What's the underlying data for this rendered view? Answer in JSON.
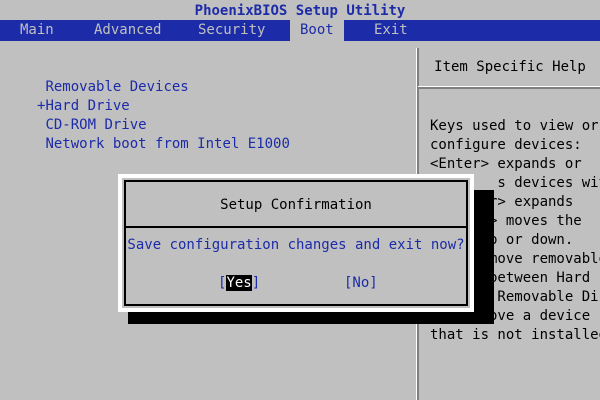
{
  "title": "PhoenixBIOS Setup Utility",
  "menu": [
    "Main",
    "Advanced",
    "Security",
    "Boot",
    "Exit"
  ],
  "active_menu": "Boot",
  "boot_items": [
    {
      "prefix": " ",
      "label": "Removable Devices"
    },
    {
      "prefix": "+",
      "label": "Hard Drive"
    },
    {
      "prefix": " ",
      "label": "CD-ROM Drive"
    },
    {
      "prefix": " ",
      "label": "Network boot from Intel E1000"
    }
  ],
  "help": {
    "header": "Item Specific Help",
    "lines": [
      "Keys used to view or",
      "configure devices:",
      "<Enter> expands or",
      "        s devices with",
      "",
      "     ter> expands",
      "",
      "     <-> moves the",
      "       p or down.",
      "       move removable",
      "device between Hard",
      "Disk or Removable Disk",
      "<d> Remove a device",
      "that is not installed."
    ]
  },
  "dialog": {
    "title": "Setup Confirmation",
    "question": "Save configuration changes and exit now?",
    "yes_open": "[",
    "yes_label": "Yes",
    "yes_close": "]",
    "no_label": "[No]"
  },
  "colors": {
    "background": "#c0c0c0",
    "bios_blue": "#1c2ba8",
    "highlight": "#000000"
  }
}
